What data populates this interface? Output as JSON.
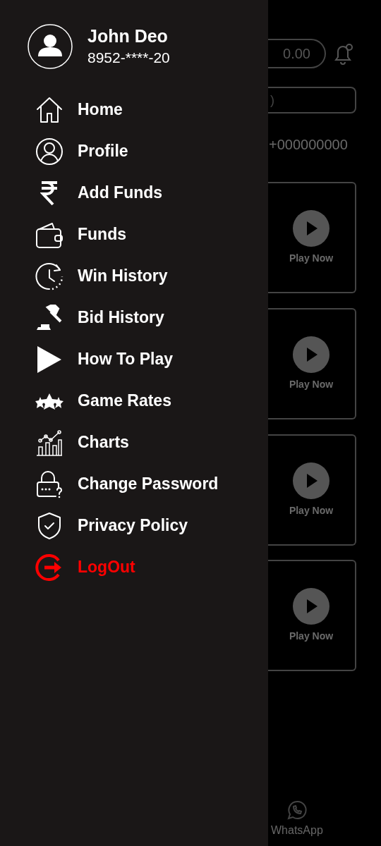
{
  "header": {
    "wallet_balance": "0.00"
  },
  "notice": {
    "text": ")"
  },
  "contact": {
    "phone": "+000000000"
  },
  "games": [
    {
      "action": "Play Now"
    },
    {
      "action": "Play Now"
    },
    {
      "action": "Play Now"
    },
    {
      "action": "Play Now"
    }
  ],
  "bottom_nav": [
    {
      "label": "WhatsApp"
    }
  ],
  "drawer": {
    "user": {
      "name": "John Deo",
      "phone": "8952-****-20"
    },
    "items": [
      {
        "label": "Home",
        "kind": "normal"
      },
      {
        "label": "Profile",
        "kind": "normal"
      },
      {
        "label": "Add Funds",
        "kind": "normal"
      },
      {
        "label": "Funds",
        "kind": "normal"
      },
      {
        "label": "Win History",
        "kind": "normal"
      },
      {
        "label": "Bid History",
        "kind": "normal"
      },
      {
        "label": "How To Play",
        "kind": "normal"
      },
      {
        "label": "Game Rates",
        "kind": "normal"
      },
      {
        "label": "Charts",
        "kind": "normal"
      },
      {
        "label": "Change Password",
        "kind": "normal"
      },
      {
        "label": "Privacy Policy",
        "kind": "normal"
      },
      {
        "label": "LogOut",
        "kind": "danger"
      }
    ]
  }
}
